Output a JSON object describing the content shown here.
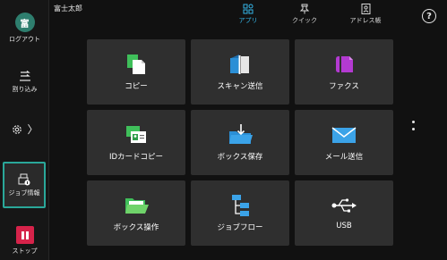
{
  "header": {
    "user_name": "富士太郎",
    "tabs": [
      {
        "label": "アプリ",
        "icon": "apps-icon",
        "active": true
      },
      {
        "label": "クイック",
        "icon": "pin-icon",
        "active": false
      },
      {
        "label": "アドレス帳",
        "icon": "address-book-icon",
        "active": false
      }
    ],
    "help_label": "?"
  },
  "sidebar": {
    "logout": {
      "avatar_text": "富",
      "label": "ログアウト"
    },
    "interrupt": {
      "label": "割り込み"
    },
    "settings": {
      "icon": "gear-icon",
      "chevron": "〉"
    },
    "job_status": {
      "label": "ジョブ情報"
    },
    "stop": {
      "label": "ストップ"
    }
  },
  "apps": [
    {
      "label": "コピー",
      "icon": "copy-icon"
    },
    {
      "label": "スキャン送信",
      "icon": "scan-send-icon"
    },
    {
      "label": "ファクス",
      "icon": "fax-icon"
    },
    {
      "label": "IDカードコピー",
      "icon": "id-card-copy-icon"
    },
    {
      "label": "ボックス保存",
      "icon": "box-save-icon"
    },
    {
      "label": "メール送信",
      "icon": "email-icon"
    },
    {
      "label": "ボックス操作",
      "icon": "box-operation-icon"
    },
    {
      "label": "ジョブフロー",
      "icon": "job-flow-icon"
    },
    {
      "label": "USB",
      "icon": "usb-icon"
    }
  ],
  "colors": {
    "accent": "#35b5e8",
    "green": "#3fbf5a",
    "blue": "#2b8fd6",
    "purple": "#b33ad1",
    "stop_red": "#d6234a",
    "selection": "#2aa89a"
  }
}
